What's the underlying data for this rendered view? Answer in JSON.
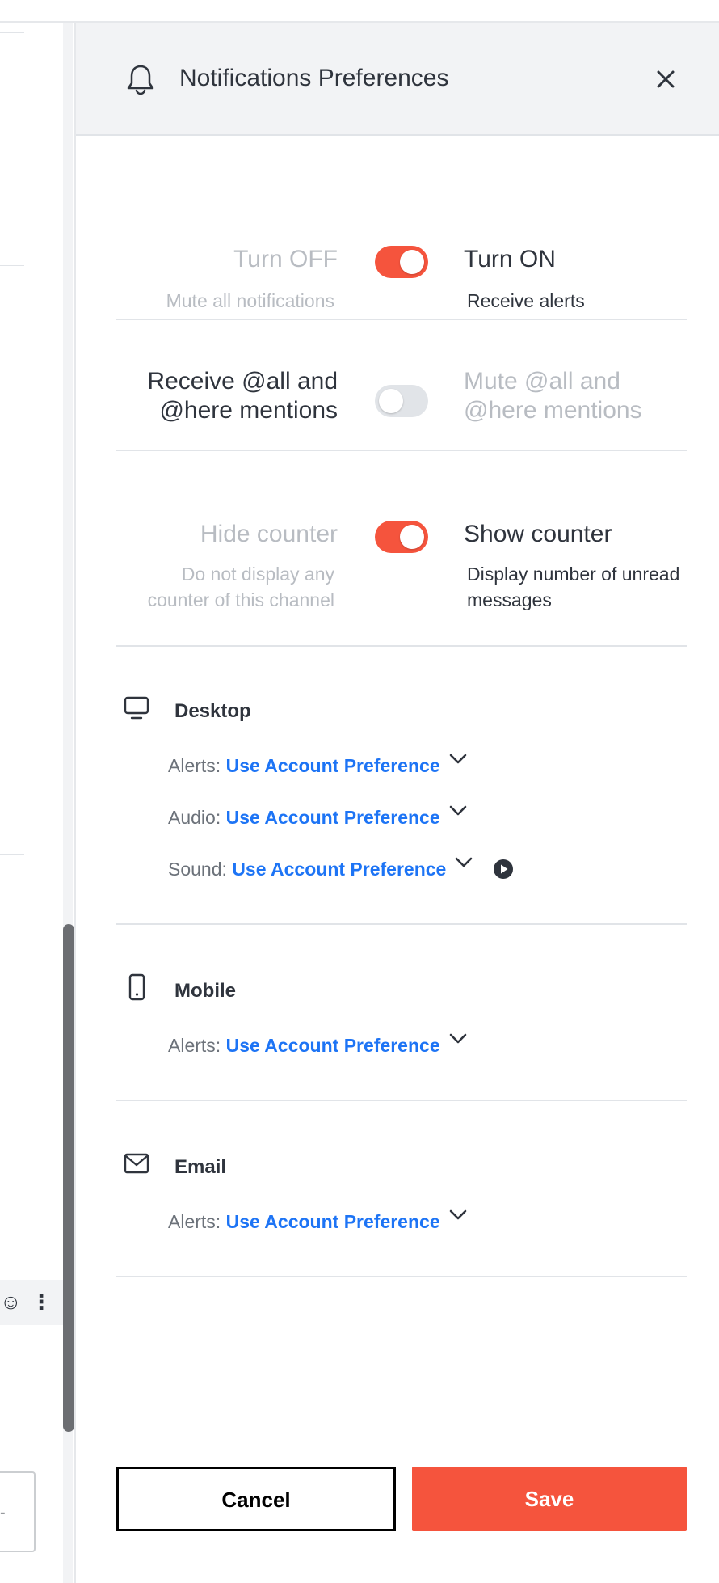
{
  "header": {
    "title": "Notifications Preferences",
    "bell_icon": "bell-icon",
    "close_icon": "close-icon"
  },
  "turn_on_off": {
    "off_label": "Turn OFF",
    "off_desc": "Mute all notifications",
    "on_label": "Turn ON",
    "on_desc": "Receive alerts",
    "state": "on"
  },
  "mentions": {
    "left_label": "Receive @all and @here mentions",
    "right_label": "Mute @all and @here mentions",
    "state": "off"
  },
  "counter": {
    "off_label": "Hide counter",
    "off_desc": "Do not display any counter of this channel",
    "on_label": "Show counter",
    "on_desc": "Display number of unread messages",
    "state": "on"
  },
  "desktop": {
    "title": "Desktop",
    "icon": "monitor-icon",
    "alerts_label": "Alerts:",
    "alerts_value": "Use Account Preference",
    "audio_label": "Audio:",
    "audio_value": "Use Account Preference",
    "sound_label": "Sound:",
    "sound_value": "Use Account Preference"
  },
  "mobile": {
    "title": "Mobile",
    "icon": "mobile-phone-icon",
    "alerts_label": "Alerts:",
    "alerts_value": "Use Account Preference"
  },
  "email": {
    "title": "Email",
    "icon": "envelope-icon",
    "alerts_label": "Alerts:",
    "alerts_value": "Use Account Preference"
  },
  "footer": {
    "cancel_label": "Cancel",
    "save_label": "Save"
  },
  "colors": {
    "accent": "#f5543d",
    "link": "#1d74f5",
    "muted": "#b8bcc2",
    "text": "#2f343d"
  }
}
